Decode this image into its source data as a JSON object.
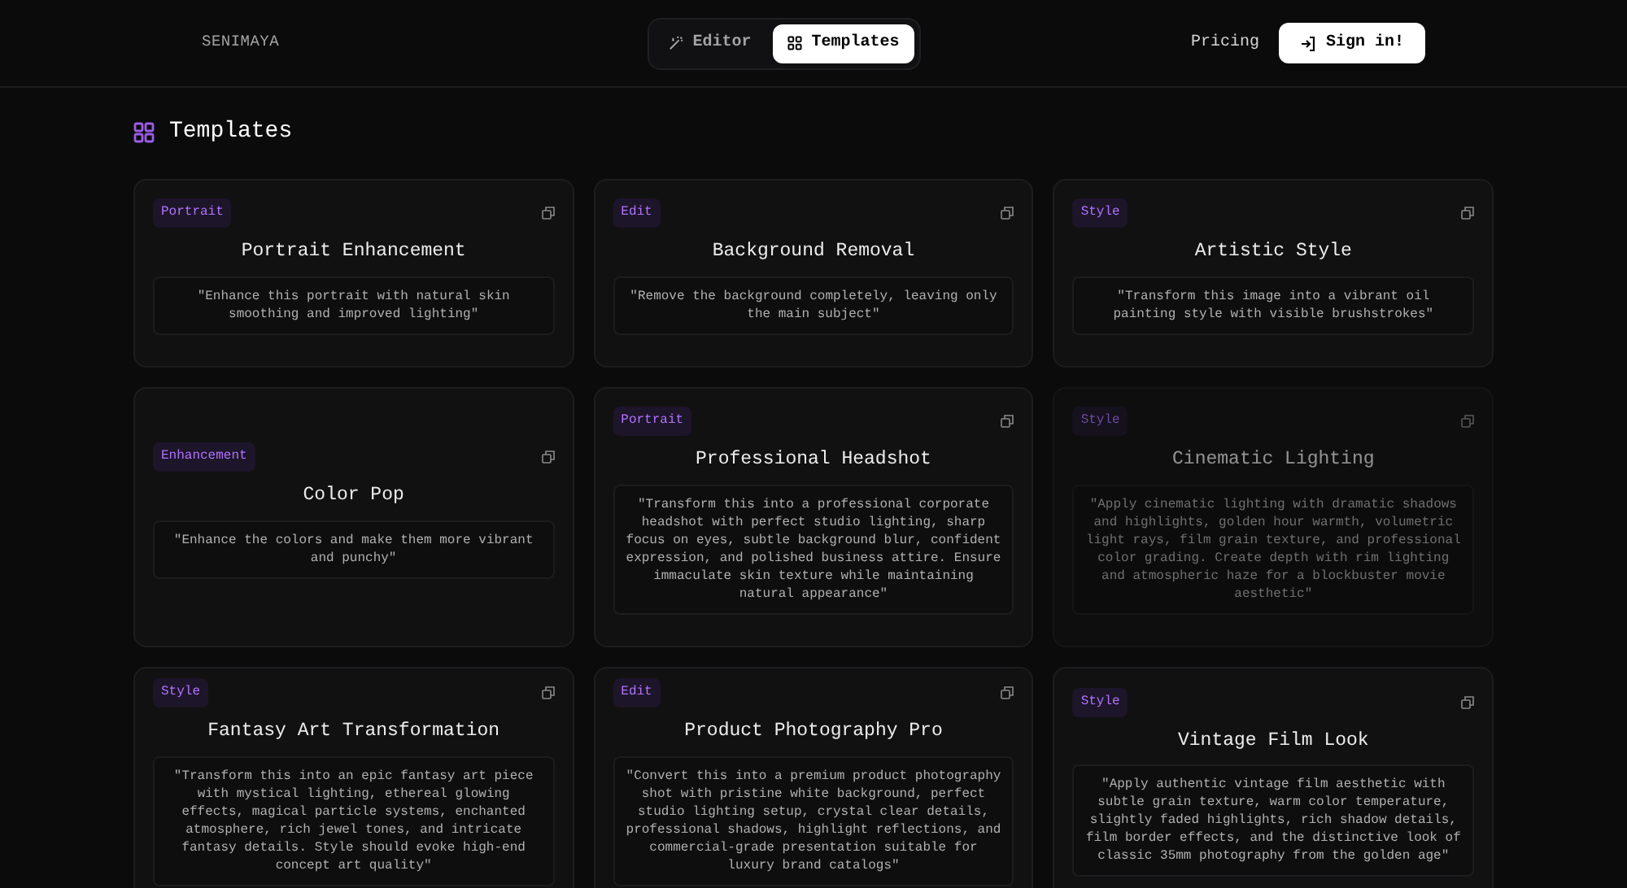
{
  "header": {
    "brand": "SENIMAYA",
    "tabs": [
      {
        "label": "Editor",
        "kind": "wand",
        "selected": false
      },
      {
        "label": "Templates",
        "kind": "grid",
        "selected": true
      }
    ],
    "pricing": "Pricing",
    "sign_in": "Sign in!"
  },
  "heading": "Templates",
  "cards": [
    {
      "tag": "Portrait",
      "title": "Portrait Enhancement",
      "prompt": "\"Enhance this portrait with natural skin smoothing and improved lighting\"",
      "dimmed": false
    },
    {
      "tag": "Edit",
      "title": "Background Removal",
      "prompt": "\"Remove the background completely, leaving only the main subject\"",
      "dimmed": false
    },
    {
      "tag": "Style",
      "title": "Artistic Style",
      "prompt": "\"Transform this image into a vibrant oil painting style with visible brushstrokes\"",
      "dimmed": false
    },
    {
      "tag": "Enhancement",
      "title": "Color Pop",
      "prompt": "\"Enhance the colors and make them more vibrant and punchy\"",
      "dimmed": false
    },
    {
      "tag": "Portrait",
      "title": "Professional Headshot",
      "prompt": "\"Transform this into a professional corporate headshot with perfect studio lighting, sharp focus on eyes, subtle background blur, confident expression, and polished business attire. Ensure immaculate skin texture while maintaining natural appearance\"",
      "dimmed": false
    },
    {
      "tag": "Style",
      "title": "Cinematic Lighting",
      "prompt": "\"Apply cinematic lighting with dramatic shadows and highlights, golden hour warmth, volumetric light rays, film grain texture, and professional color grading. Create depth with rim lighting and atmospheric haze for a blockbuster movie aesthetic\"",
      "dimmed": true
    },
    {
      "tag": "Style",
      "title": "Fantasy Art Transformation",
      "prompt": "\"Transform this into an epic fantasy art piece with mystical lighting, ethereal glowing effects, magical particle systems, enchanted atmosphere, rich jewel tones, and intricate fantasy details. Style should evoke high-end concept art quality\"",
      "dimmed": false
    },
    {
      "tag": "Edit",
      "title": "Product Photography Pro",
      "prompt": "\"Convert this into a premium product photography shot with pristine white background, perfect studio lighting setup, crystal clear details, professional shadows, highlight reflections, and commercial-grade presentation suitable for luxury brand catalogs\"",
      "dimmed": false
    },
    {
      "tag": "Style",
      "title": "Vintage Film Look",
      "prompt": "\"Apply authentic vintage film aesthetic with subtle grain texture, warm color temperature, slightly faded highlights, rich shadow details, film border effects, and the distinctive look of classic 35mm photography from the golden age\"",
      "dimmed": false
    }
  ]
}
